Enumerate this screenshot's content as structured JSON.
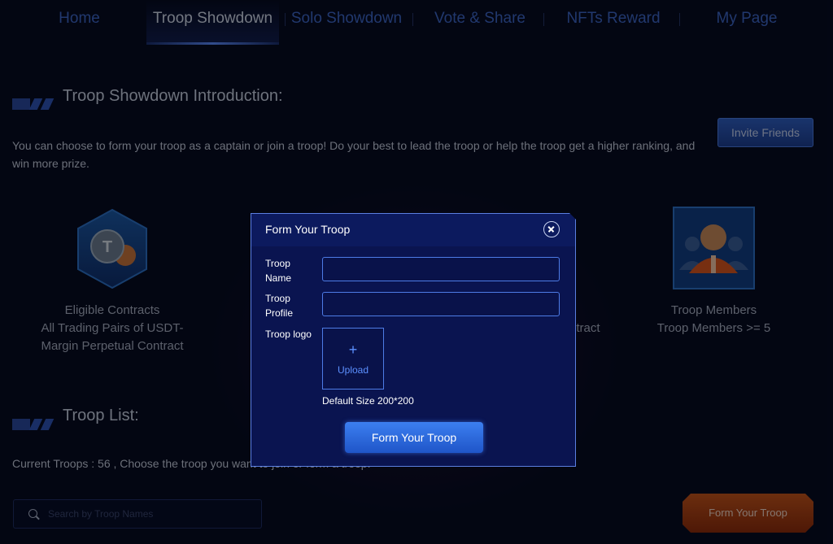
{
  "nav": {
    "items": [
      {
        "label": "Home"
      },
      {
        "label": "Troop Showdown"
      },
      {
        "label": "Solo Showdown"
      },
      {
        "label": "Vote & Share"
      },
      {
        "label": "NFTs Reward"
      },
      {
        "label": "My Page"
      }
    ],
    "active_index": 1
  },
  "intro": {
    "title": "Troop Showdown Introduction:",
    "text": "You can choose to form your troop as a captain or join a troop! Do your best to lead the troop or help the troop get a higher ranking, and win more prize.",
    "invite_label": "Invite Friends"
  },
  "requirements": [
    {
      "icon": "tether-coin-icon",
      "lines": [
        "Eligible Contracts",
        "All Trading Pairs of USDT-",
        "Margin Perpetual Contract"
      ]
    },
    {
      "icon": "contract-icon",
      "lines": [
        "ntract"
      ]
    },
    {
      "icon": "troop-members-icon",
      "lines": [
        "Troop Members",
        "Troop Members >= 5"
      ]
    }
  ],
  "troop_list": {
    "title": "Troop List:",
    "current": "Current Troops : 56 , Choose the troop you want to join or form a troop.",
    "search_placeholder": "Search by Troop Names",
    "form_button": "Form Your Troop"
  },
  "modal": {
    "title": "Form Your Troop",
    "name_label": "Troop Name",
    "profile_label": "Troop Profile",
    "logo_label": "Troop logo",
    "name_value": "",
    "profile_value": "",
    "upload_plus": "+",
    "upload_label": "Upload",
    "size_note": "Default Size 200*200",
    "submit_label": "Form Your Troop"
  },
  "colors": {
    "background": "#060b22",
    "nav_inactive": "#3d67c8",
    "accent_blue": "#3c7ff0",
    "accent_orange": "#c4541c"
  }
}
